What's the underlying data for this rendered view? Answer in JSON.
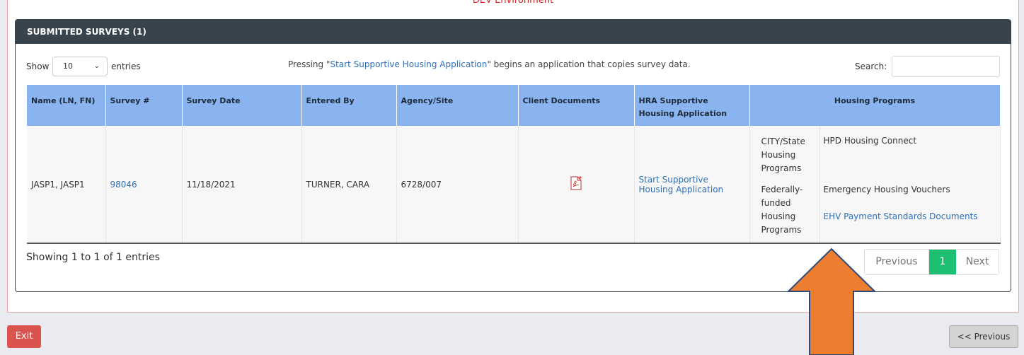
{
  "environment_banner": "DEV Environment",
  "panel": {
    "title": "SUBMITTED SURVEYS (1)"
  },
  "toolbar": {
    "show_label": "Show",
    "entries_value": "10",
    "entries_label": "entries",
    "note_prefix": "Pressing \"",
    "note_link": "Start Supportive Housing Application",
    "note_suffix": "\" begins an application that copies survey data.",
    "search_label": "Search:",
    "search_value": ""
  },
  "table": {
    "headers": [
      "Name (LN, FN)",
      "Survey #",
      "Survey Date",
      "Entered By",
      "Agency/Site",
      "Client Documents",
      "HRA Supportive Housing Application",
      "Housing Programs"
    ],
    "row": {
      "name": "JASP1, JASP1",
      "survey_number": "98046",
      "survey_date": "11/18/2021",
      "entered_by": "TURNER, CARA",
      "agency_site": "6728/007",
      "document_icon": "pdf-icon",
      "application_link": "Start Supportive Housing Application",
      "housing_programs": [
        {
          "category": "CITY/State Housing Programs",
          "program": "HPD Housing Connect"
        },
        {
          "category": "Federally-funded Housing Programs",
          "program": "Emergency Housing Vouchers",
          "link": "EHV Payment Standards Documents"
        }
      ]
    }
  },
  "footer": {
    "showing": "Showing 1 to 1 of 1 entries",
    "prev_label": "Previous",
    "current_page": "1",
    "next_label": "Next"
  },
  "buttons": {
    "exit": "Exit",
    "previous_page": "<< Previous"
  },
  "colors": {
    "header_bg": "#37434d",
    "table_header_bg": "#8ab4f0",
    "active_page": "#1dbf73",
    "exit_bg": "#d9534f",
    "arrow": "#ed7d31"
  }
}
